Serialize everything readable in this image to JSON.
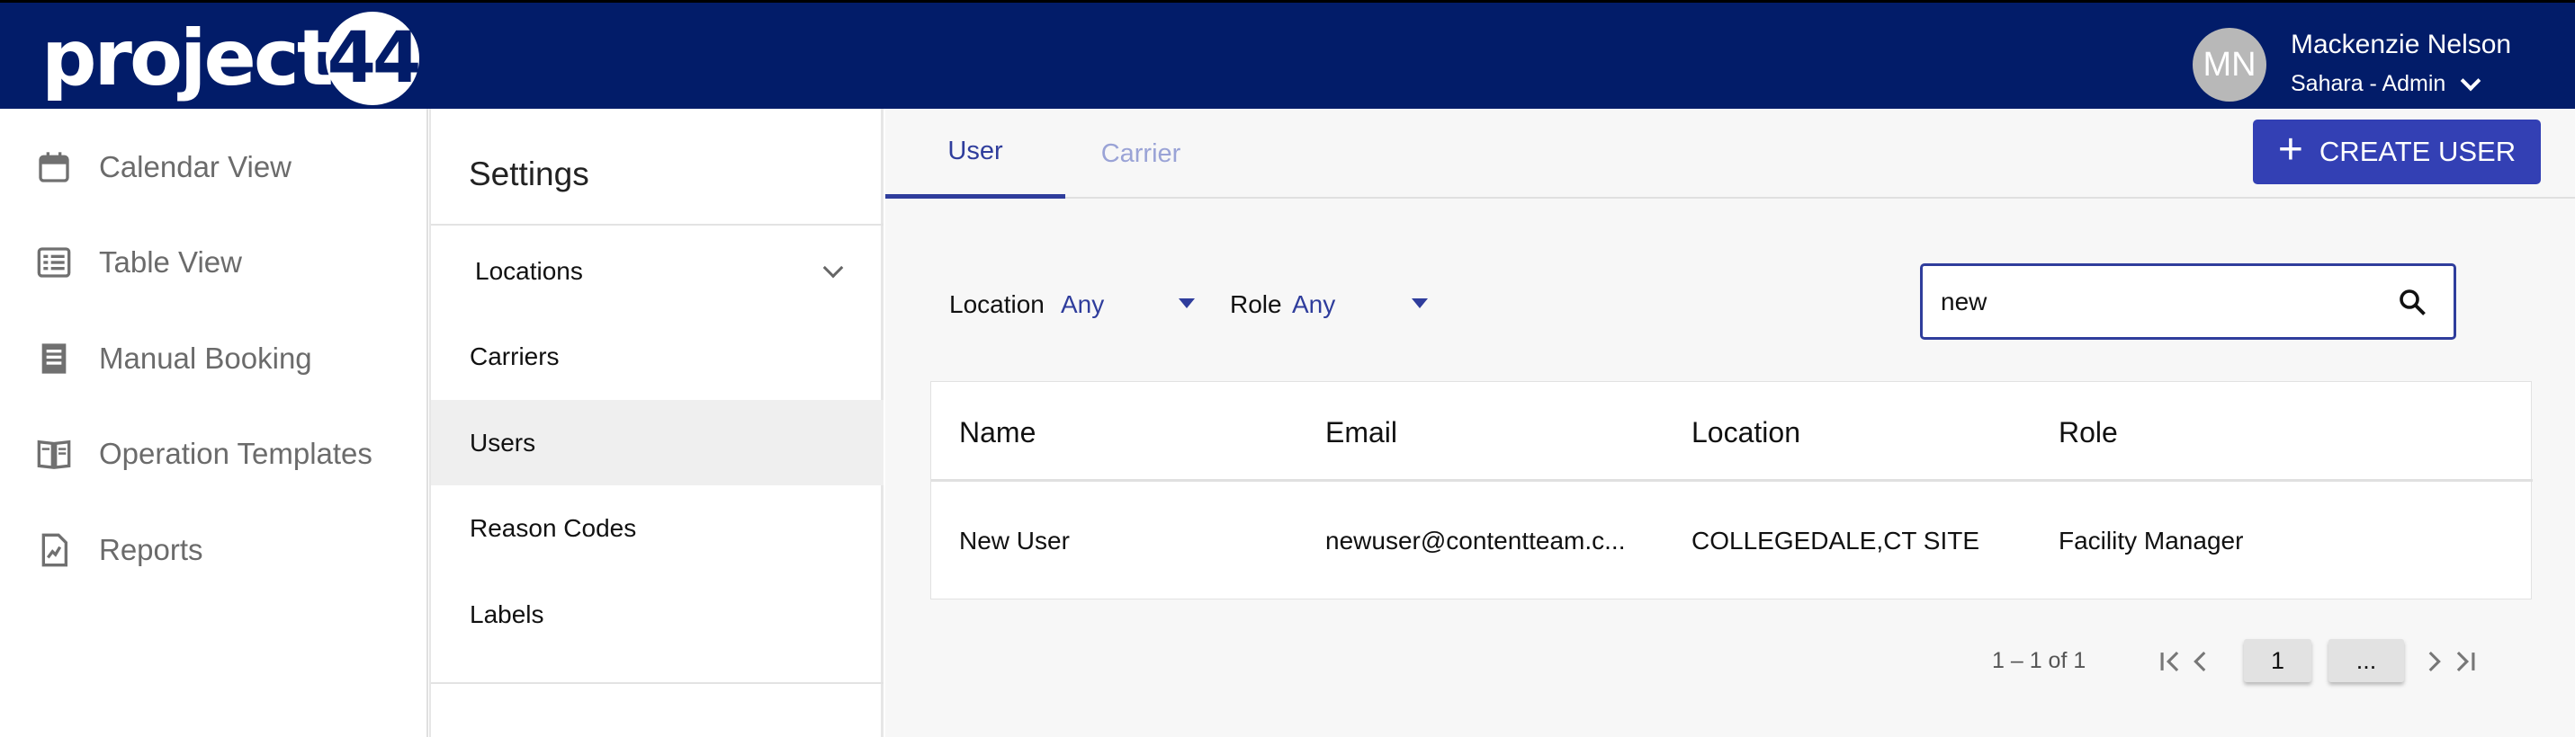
{
  "header": {
    "logo_text": "project",
    "logo_number": "44",
    "avatar_initials": "MN",
    "user_name": "Mackenzie Nelson",
    "user_org": "Sahara - Admin"
  },
  "sidebar": {
    "items": [
      {
        "label": "Calendar View",
        "icon": "calendar-icon"
      },
      {
        "label": "Table View",
        "icon": "list-icon"
      },
      {
        "label": "Manual Booking",
        "icon": "receipt-icon"
      },
      {
        "label": "Operation Templates",
        "icon": "book-icon"
      },
      {
        "label": "Reports",
        "icon": "report-icon"
      }
    ]
  },
  "settings": {
    "title": "Settings",
    "items": [
      {
        "label": "Locations"
      },
      {
        "label": "Carriers"
      },
      {
        "label": "Users"
      },
      {
        "label": "Reason Codes"
      },
      {
        "label": "Labels"
      }
    ],
    "active_item": "Users"
  },
  "main": {
    "tabs": [
      {
        "label": "User"
      },
      {
        "label": "Carrier"
      }
    ],
    "create_button_label": "CREATE USER",
    "filters": {
      "location_label": "Location",
      "location_value": "Any",
      "role_label": "Role",
      "role_value": "Any"
    },
    "search_value": "new",
    "table": {
      "headers": [
        "Name",
        "Email",
        "Location",
        "Role"
      ],
      "rows": [
        [
          "New User",
          "newuser@contentteam.c...",
          "COLLEGEDALE,CT SITE",
          "Facility Manager"
        ]
      ]
    },
    "pagination": {
      "range": "1 – 1 of 1",
      "current_page": "1",
      "more": "..."
    }
  },
  "colors": {
    "header_bg": "#021c69",
    "accent": "#3340b4",
    "tab_active": "#2f3d9c"
  }
}
